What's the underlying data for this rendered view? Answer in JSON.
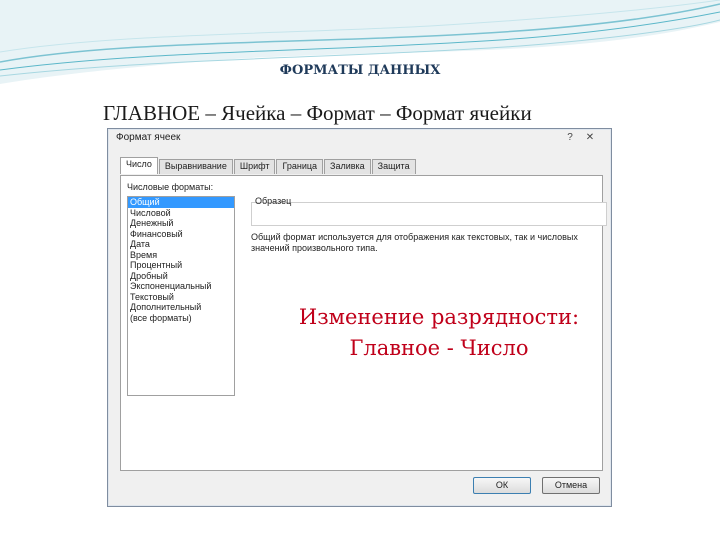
{
  "slide": {
    "heading": "ФОРМАТЫ ДАННЫХ",
    "menu_path": "ГЛАВНОЕ – Ячейка – Формат – Формат ячейки"
  },
  "dialog": {
    "title": "Формат ячеек",
    "help_glyph": "?",
    "close_glyph": "✕",
    "tabs": [
      "Число",
      "Выравнивание",
      "Шрифт",
      "Граница",
      "Заливка",
      "Защита"
    ],
    "active_tab": "Число",
    "categories_label": "Числовые форматы:",
    "categories": [
      "Общий",
      "Числовой",
      "Денежный",
      "Финансовый",
      "Дата",
      "Время",
      "Процентный",
      "Дробный",
      "Экспоненциальный",
      "Текстовый",
      "Дополнительный",
      "(все форматы)"
    ],
    "selected_category": "Общий",
    "sample_label": "Образец",
    "description": "Общий формат используется для отображения как текстовых, так и числовых значений произвольного типа.",
    "ok_label": "ОК",
    "cancel_label": "Отмена"
  },
  "callout": {
    "line1": "Изменение разрядности:",
    "line2": "Главное - Число"
  },
  "colors": {
    "callout": "#c0001a",
    "selection": "#3399ff",
    "decoration_teal": "#5bb7c9"
  }
}
